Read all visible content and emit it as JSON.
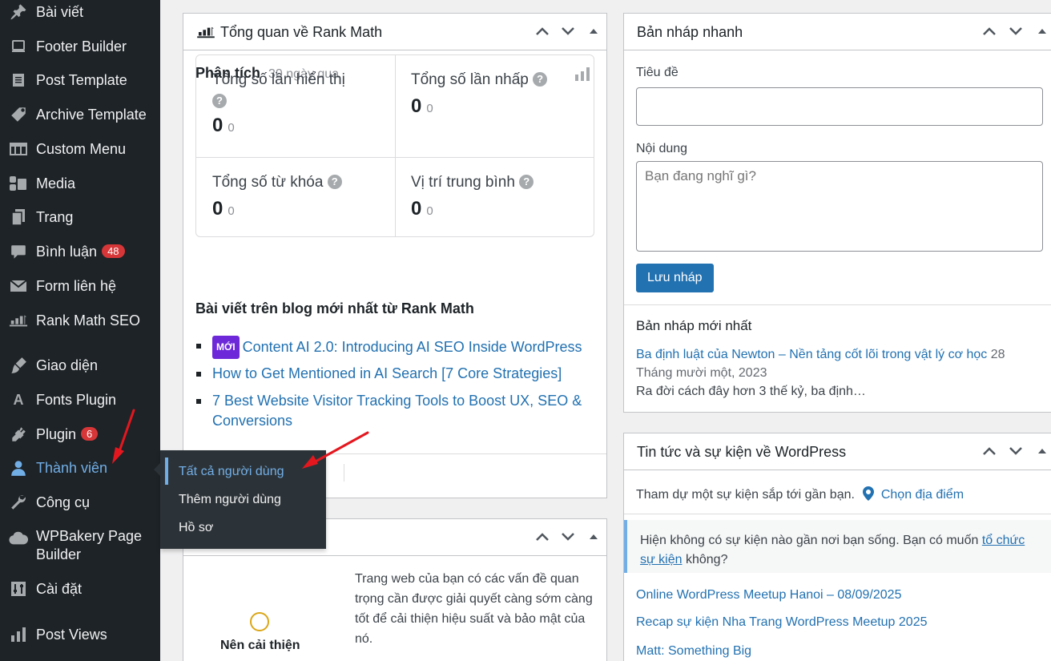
{
  "sidebar": {
    "items": [
      {
        "label": "Bài viết",
        "icon": "pin-icon"
      },
      {
        "label": "Footer Builder",
        "icon": "screen-icon"
      },
      {
        "label": "Post Template",
        "icon": "document-icon"
      },
      {
        "label": "Archive Template",
        "icon": "tag-icon"
      },
      {
        "label": "Custom Menu",
        "icon": "grid-icon"
      },
      {
        "label": "Media",
        "icon": "media-icon"
      },
      {
        "label": "Trang",
        "icon": "pages-icon"
      },
      {
        "label": "Bình luận",
        "icon": "comment-icon",
        "badge": "48"
      },
      {
        "label": "Form liên hệ",
        "icon": "mail-icon"
      },
      {
        "label": "Rank Math SEO",
        "icon": "rankmath-icon"
      },
      {
        "label": "Giao diện",
        "icon": "brush-icon"
      },
      {
        "label": "Fonts Plugin",
        "icon": "font-icon"
      },
      {
        "label": "Plugin",
        "icon": "plug-icon",
        "badge": "6"
      },
      {
        "label": "Thành viên",
        "icon": "user-icon"
      },
      {
        "label": "Công cụ",
        "icon": "wrench-icon"
      },
      {
        "label": "WPBakery Page",
        "label2": "Builder",
        "icon": "cloud-icon"
      },
      {
        "label": "Cài đặt",
        "icon": "settings-icon"
      },
      {
        "label": "Post Views",
        "icon": "chart-icon"
      }
    ],
    "font_icon_glyph": "A"
  },
  "submenu": {
    "items": [
      "Tất cả người dùng",
      "Thêm người dùng",
      "Hồ sơ"
    ]
  },
  "rankmath": {
    "title": "Tổng quan về Rank Math",
    "analysis_label": "Phân tích",
    "analysis_period": "30 ngày qua",
    "stats": [
      {
        "label": "Tổng số lần hiển thị",
        "value": "0",
        "sub": "0"
      },
      {
        "label": "Tổng số lần nhấp",
        "value": "0",
        "sub": "0"
      },
      {
        "label": "Tổng số từ khóa",
        "value": "0",
        "sub": "0"
      },
      {
        "label": "Vị trí trung bình",
        "value": "0",
        "sub": "0"
      }
    ],
    "help_glyph": "?",
    "blog_heading": "Bài viết trên blog mới nhất từ Rank Math",
    "new_badge": "MỚI",
    "blog_posts": [
      "Content AI 2.0: Introducing AI SEO Inside WordPress",
      "How to Get Mentioned in AI Search [7 Core Strategies]",
      "7 Best Website Visitor Tracking Tools to Boost UX, SEO & Conversions"
    ]
  },
  "site_health": {
    "status_label": "Nên cải thiện",
    "description": "Trang web của bạn có các vấn đề quan trọng cần được giải quyết càng sớm càng tốt để cải thiện hiệu suất và bảo mật của nó."
  },
  "quick_draft": {
    "title": "Bản nháp nhanh",
    "title_label": "Tiêu đề",
    "title_value": "",
    "content_label": "Nội dung",
    "content_placeholder": "Bạn đang nghĩ gì?",
    "save_button": "Lưu nháp",
    "recent_heading": "Bản nháp mới nhất",
    "recent_link": "Ba định luật của Newton – Nền tảng cốt lõi trong vật lý cơ học",
    "recent_date_part1": "28",
    "recent_date_part2": "Tháng mười một, 2023",
    "recent_excerpt": "Ra đời cách đây hơn 3 thế kỷ, ba định…"
  },
  "wp_news": {
    "title": "Tin tức và sự kiện về WordPress",
    "attend_text": "Tham dự một sự kiện sắp tới gần bạn.",
    "choose_location": "Chọn địa điểm",
    "no_events_text": "Hiện không có sự kiện nào gần nơi bạn sống. Bạn có muốn",
    "organize_link_1": "tổ chức",
    "organize_link_2": "sự kiện",
    "no_events_tail": "không?",
    "events": [
      "Online WordPress Meetup Hanoi – 08/09/2025",
      "Recap sự kiện Nha Trang WordPress Meetup 2025",
      "Matt: Something Big"
    ]
  },
  "colors": {
    "sidebar_bg": "#1d2327",
    "accent": "#2271b1",
    "badge": "#d63638",
    "annotation": "#e4171f"
  }
}
